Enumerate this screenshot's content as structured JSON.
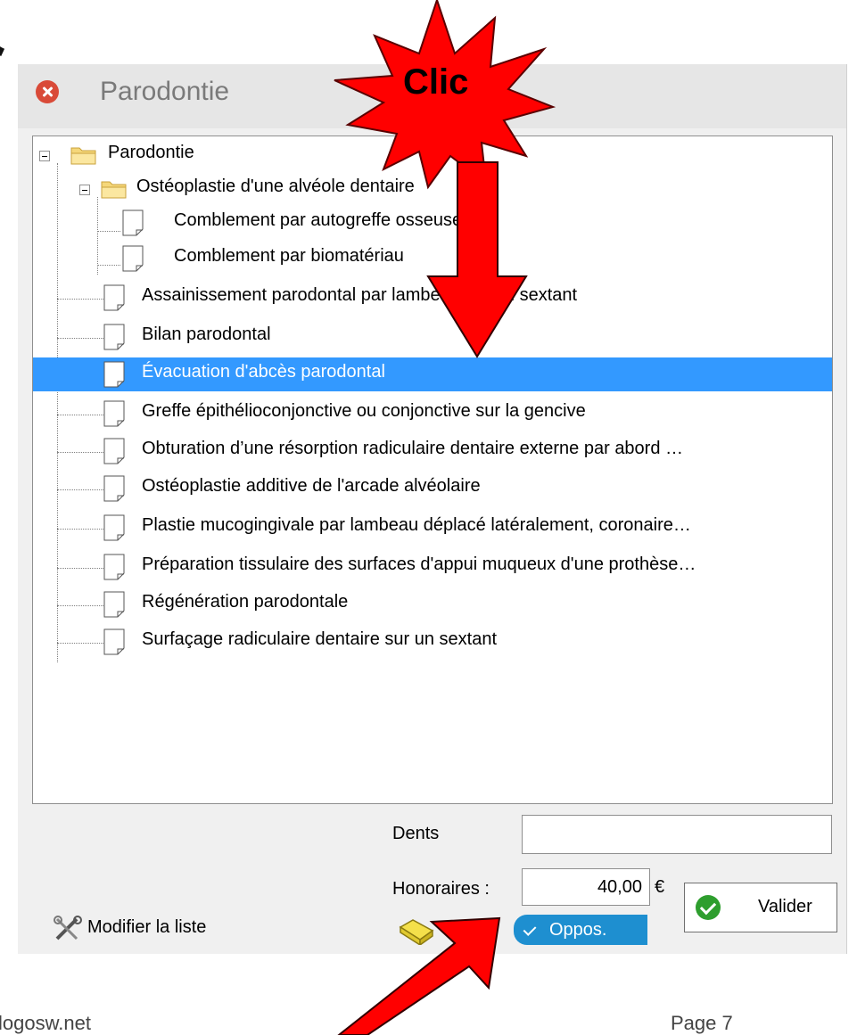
{
  "window": {
    "title": "Parodontie"
  },
  "tree": {
    "root": "Parodontie",
    "items": [
      "Ostéoplastie d'une alvéole dentaire",
      "Comblement par autogreffe osseuse",
      "Comblement par biomatériau",
      "Assainissement parodontal par lambeau sur un sextant",
      "Bilan parodontal",
      "Évacuation d'abcès parodontal",
      "Greffe épithélioconjonctive ou conjonctive sur la gencive",
      "Obturation d’une résorption radiculaire dentaire externe par abord …",
      "Ostéoplastie additive de l'arcade alvéolaire",
      "Plastie mucogingivale par lambeau déplacé latéralement, coronaire…",
      "Préparation tissulaire des surfaces d'appui muqueux d'une prothèse…",
      "Régénération parodontale",
      "Surfaçage radiculaire dentaire sur un sextant"
    ],
    "selected": "Évacuation d'abcès parodontal"
  },
  "form": {
    "dents_label": "Dents",
    "dents_value": "",
    "honoraires_label": "Honoraires :",
    "honoraires_value": "40,00",
    "currency": "€"
  },
  "buttons": {
    "valider": "Valider",
    "modifier": "Modifier la liste",
    "oppos": "Oppos."
  },
  "annotation": {
    "star_text": "Clic"
  },
  "footer": {
    "left": "logosw.net",
    "right": "Page 7"
  },
  "colors": {
    "selection": "#3399ff",
    "oppos": "#1e8fd0",
    "arrow": "#ff0000",
    "close": "#d94a38"
  },
  "icons": [
    "close-icon",
    "folder-icon",
    "document-icon",
    "tools-icon",
    "eraser-icon",
    "check-icon"
  ]
}
